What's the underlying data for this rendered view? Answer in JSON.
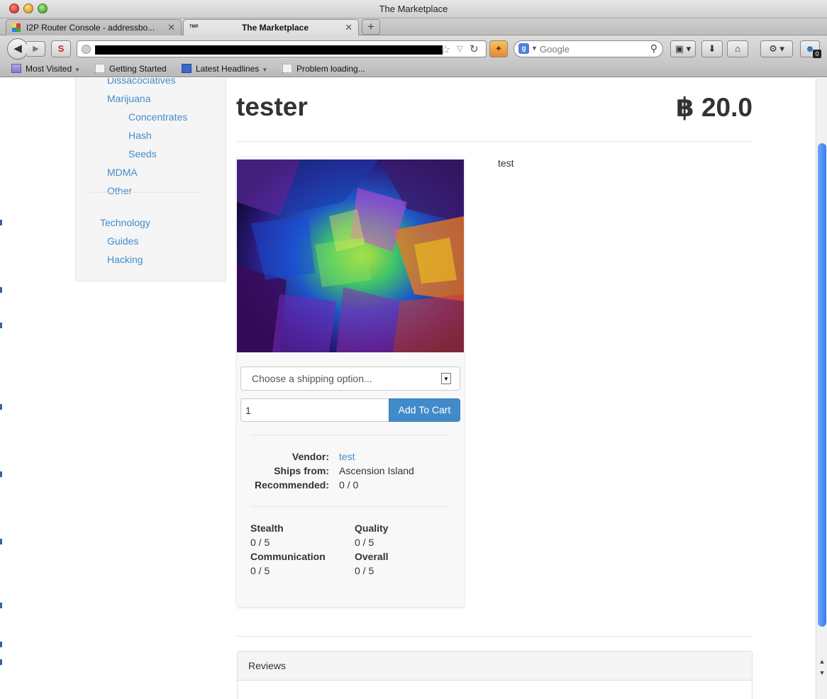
{
  "window": {
    "title": "The Marketplace"
  },
  "tabs": [
    {
      "label": "I2P Router Console - addressbo...",
      "active": false
    },
    {
      "label": "The Marketplace",
      "active": true
    }
  ],
  "toolbar": {
    "search_placeholder": "Google",
    "badge_count": "0"
  },
  "bookmarks": [
    {
      "label": "Most Visited",
      "icon": "folder-icon"
    },
    {
      "label": "Getting Started",
      "icon": "page-icon"
    },
    {
      "label": "Latest Headlines",
      "icon": "rss-icon"
    },
    {
      "label": "Problem loading...",
      "icon": "page-icon"
    }
  ],
  "sidebar": {
    "items": [
      {
        "label": "Dissacociatives",
        "level": 1
      },
      {
        "label": "Marijuana",
        "level": 1
      },
      {
        "label": "Concentrates",
        "level": 2
      },
      {
        "label": "Hash",
        "level": 2
      },
      {
        "label": "Seeds",
        "level": 2
      },
      {
        "label": "MDMA",
        "level": 1
      },
      {
        "label": "Other",
        "level": 1
      },
      {
        "label": "Technology",
        "level": 0
      },
      {
        "label": "Guides",
        "level": 1
      },
      {
        "label": "Hacking",
        "level": 1
      }
    ]
  },
  "product": {
    "title": "tester",
    "price": "฿ 20.0",
    "description": "test",
    "shipping_placeholder": "Choose a shipping option...",
    "quantity": "1",
    "add_to_cart_label": "Add To Cart",
    "info": [
      {
        "label": "Vendor:",
        "value": "test",
        "is_link": true
      },
      {
        "label": "Ships from:",
        "value": "Ascension Island",
        "is_link": false
      },
      {
        "label": "Recommended:",
        "value": "0 / 0",
        "is_link": false
      }
    ],
    "ratings": [
      {
        "label": "Stealth",
        "value": "0 / 5"
      },
      {
        "label": "Quality",
        "value": "0 / 5"
      },
      {
        "label": "Communication",
        "value": "0 / 5"
      },
      {
        "label": "Overall",
        "value": "0 / 5"
      }
    ]
  },
  "reviews": {
    "heading": "Reviews"
  },
  "colors": {
    "link": "#428bca",
    "button": "#428bca"
  }
}
